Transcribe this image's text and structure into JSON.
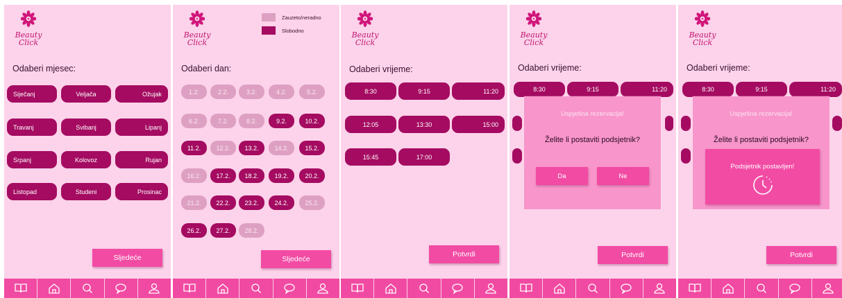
{
  "app": {
    "logo_line1": "Beauty",
    "logo_line2": "Click"
  },
  "colors": {
    "free": "#a40b61",
    "busy": "#dea0c2",
    "accent": "#f24ba4",
    "background": "#fcd3ea"
  },
  "nav_icons": [
    "book-icon",
    "home-icon",
    "search-icon",
    "chat-icon",
    "user-icon"
  ],
  "screen1": {
    "heading": "Odaberi mjesec:",
    "months": [
      "Siječanj",
      "Veljača",
      "Ožujak",
      "Travanj",
      "Svibanj",
      "Lipanj",
      "Srpanj",
      "Kolovoz",
      "Rujan",
      "Listopad",
      "Studeni",
      "Prosinac"
    ],
    "next_button": "Sljedeće"
  },
  "screen2": {
    "heading": "Odaberi dan:",
    "legend_busy": "Zauzeto/neradno",
    "legend_free": "Slobodno",
    "days": [
      {
        "label": "1.2.",
        "status": "busy"
      },
      {
        "label": "2.2.",
        "status": "busy"
      },
      {
        "label": "3.2.",
        "status": "busy"
      },
      {
        "label": "4.2.",
        "status": "busy"
      },
      {
        "label": "5.2.",
        "status": "busy"
      },
      {
        "label": "6.2.",
        "status": "busy"
      },
      {
        "label": "7.2.",
        "status": "busy"
      },
      {
        "label": "8.2.",
        "status": "busy"
      },
      {
        "label": "9.2.",
        "status": "free"
      },
      {
        "label": "10.2.",
        "status": "free"
      },
      {
        "label": "11.2.",
        "status": "free"
      },
      {
        "label": "12.2.",
        "status": "busy"
      },
      {
        "label": "13.2.",
        "status": "free"
      },
      {
        "label": "14.2.",
        "status": "busy"
      },
      {
        "label": "15.2.",
        "status": "free"
      },
      {
        "label": "16.2.",
        "status": "busy"
      },
      {
        "label": "17.2.",
        "status": "free"
      },
      {
        "label": "18.2.",
        "status": "free"
      },
      {
        "label": "19.2.",
        "status": "free"
      },
      {
        "label": "20.2.",
        "status": "free"
      },
      {
        "label": "21.2.",
        "status": "busy"
      },
      {
        "label": "22.2.",
        "status": "free"
      },
      {
        "label": "23.2.",
        "status": "free"
      },
      {
        "label": "24.2.",
        "status": "free"
      },
      {
        "label": "25.2.",
        "status": "busy"
      },
      {
        "label": "26.2.",
        "status": "free"
      },
      {
        "label": "27.2.",
        "status": "free"
      },
      {
        "label": "28.2.",
        "status": "busy"
      }
    ],
    "next_button": "Sljedeće"
  },
  "screen3": {
    "heading": "Odaberi vrijeme:",
    "times": [
      "8:30",
      "9:15",
      "11:20",
      "12:05",
      "13:30",
      "15:00",
      "15:45",
      "17:00"
    ],
    "confirm_button": "Potvrdi"
  },
  "screen4": {
    "heading": "Odaberi vrijeme:",
    "times": [
      "8:30",
      "9:15",
      "11:20"
    ],
    "dialog_title": "Uspješna rezervacija!",
    "dialog_question": "Želite li postaviti podsjetnik?",
    "yes_button": "Da",
    "no_button": "Ne",
    "confirm_button": "Potvrdi"
  },
  "screen5": {
    "heading": "Odaberi vrijeme:",
    "times": [
      "8:30",
      "9:15",
      "11:20"
    ],
    "dialog_title": "Uspješna rezervacija!",
    "dialog_question": "Želite li postaviti podsjetnik?",
    "toast_text": "Podsjetnik postavljen!",
    "confirm_button": "Potvrdi"
  }
}
